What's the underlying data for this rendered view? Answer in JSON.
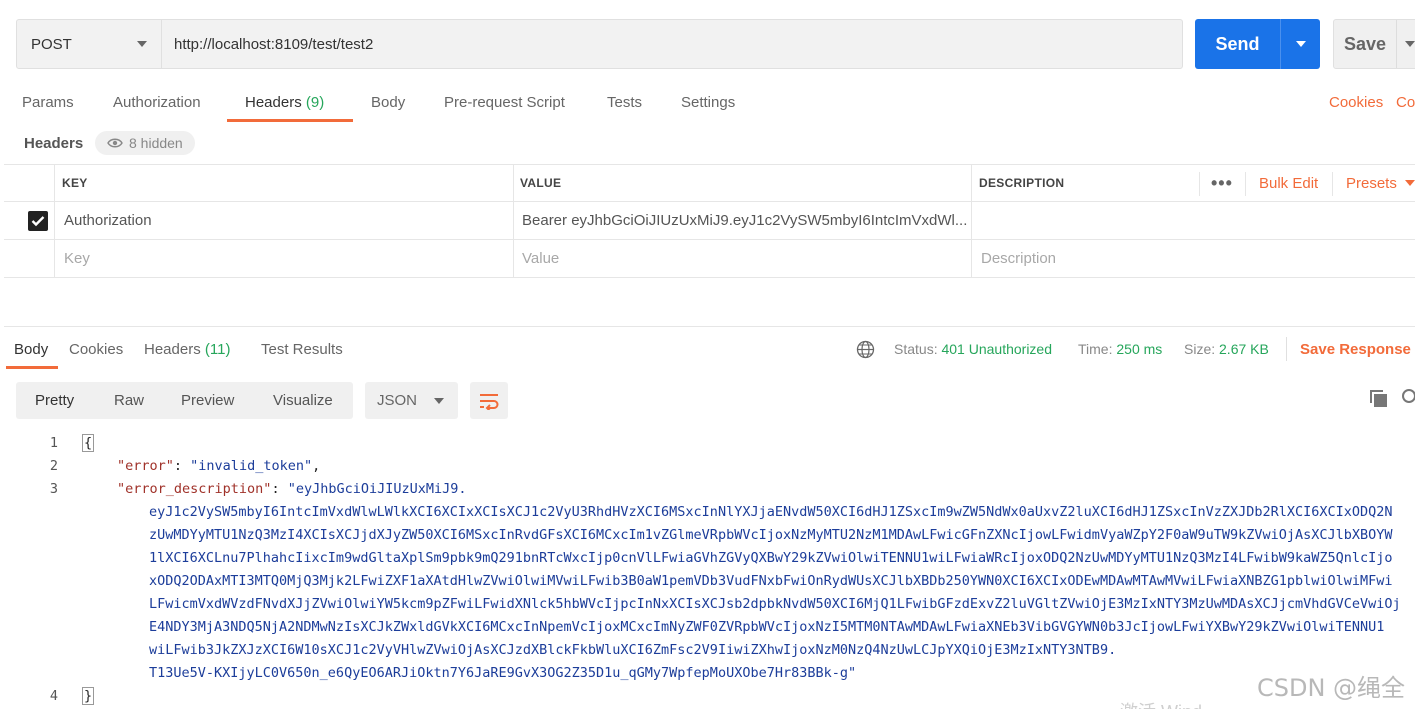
{
  "request": {
    "method": "POST",
    "url": "http://localhost:8109/test/test2",
    "send_label": "Send",
    "save_label": "Save"
  },
  "request_tabs": [
    {
      "label": "Params"
    },
    {
      "label": "Authorization"
    },
    {
      "label": "Headers",
      "count": "(9)"
    },
    {
      "label": "Body"
    },
    {
      "label": "Pre-request Script"
    },
    {
      "label": "Tests"
    },
    {
      "label": "Settings"
    }
  ],
  "right_links": {
    "cookies": "Cookies",
    "code": "Co"
  },
  "headers_section": {
    "title": "Headers",
    "hidden": "8 hidden"
  },
  "headers_table": {
    "columns": {
      "key": "KEY",
      "value": "VALUE",
      "description": "DESCRIPTION"
    },
    "more": "•••",
    "bulk_edit": "Bulk Edit",
    "presets": "Presets",
    "rows": [
      {
        "key": "Authorization",
        "value": "Bearer eyJhbGciOiJIUzUxMiJ9.eyJ1c2VySW5mbyI6IntcImVxdWl..."
      }
    ],
    "placeholder": {
      "key": "Key",
      "value": "Value",
      "description": "Description"
    }
  },
  "response_tabs": [
    {
      "label": "Body"
    },
    {
      "label": "Cookies"
    },
    {
      "label": "Headers",
      "count": "(11)"
    },
    {
      "label": "Test Results"
    }
  ],
  "response_status": {
    "status_label": "Status:",
    "status_value": "401 Unauthorized",
    "time_label": "Time:",
    "time_value": "250 ms",
    "size_label": "Size:",
    "size_value": "2.67 KB",
    "save_response": "Save Response"
  },
  "format_tabs": [
    "Pretty",
    "Raw",
    "Preview",
    "Visualize"
  ],
  "format_select": "JSON",
  "code": {
    "line_numbers": [
      "1",
      "2",
      "3",
      "4"
    ],
    "open_brace": "{",
    "close_brace": "}",
    "error_key": "\"error\"",
    "error_value": "\"invalid_token\"",
    "desc_key": "\"error_description\"",
    "desc_lines": [
      "\"eyJhbGciOiJIUzUxMiJ9.",
      "eyJ1c2VySW5mbyI6IntcImVxdWlwLWlkXCI6XCIxXCIsXCJ1c2VyU3RhdHVzXCI6MSxcInNlYXJjaENvdW50XCI6dHJ1ZSxcIm9wZW5NdWx0aUxvZ2luXCI6dHJ1ZSxcInVzZXJDb2RlXCI6XCIxODQ2N",
      "zUwMDYyMTU1NzQ3MzI4XCIsXCJjdXJyZW50XCI6MSxcInRvdGFsXCI6MCxcIm1vZGlmeVRpbWVcIjoxNzMyMTU2NzM1MDAwLFwicGFnZXNcIjowLFwidmVyaWZpY2F0aW9uTW9kZVwiOjAsXCJlbXBOYW",
      "1lXCI6XCLnu7PlhahcIixcIm9wdGltaXplSm9pbk9mQ291bnRTcWxcIjp0cnVlLFwiaGVhZGVyQXBwY29kZVwiOlwiTENNU1wiLFwiaWRcIjoxODQ2NzUwMDYyMTU1NzQ3MzI4LFwibW9kaWZ5QnlcIjo",
      "xODQ2ODAxMTI3MTQ0MjQ3Mjk2LFwiZXF1aXAtdHlwZVwiOlwiMVwiLFwib3B0aW1pemVDb3VudFNxbFwiOnRydWUsXCJlbXBDb250YWN0XCI6XCIxODEwMDAwMTAwMVwiLFwiaXNBZG1pblwiOlwiMFwi",
      "LFwicmVxdWVzdFNvdXJjZVwiOlwiYW5kcm9pZFwiLFwidXNlck5hbWVcIjpcInNxXCIsXCJsb2dpbkNvdW50XCI6MjQ1LFwibGFzdExvZ2luVGltZVwiOjE3MzIxNTY3MzUwMDAsXCJjcmVhdGVCeVwiOj",
      "E4NDY3MjA3NDQ5NjA2NDMwNzIsXCJkZWxldGVkXCI6MCxcInNpemVcIjoxMCxcImNyZWF0ZVRpbWVcIjoxNzI5MTM0NTAwMDAwLFwiaXNEb3VibGVGYWN0b3JcIjowLFwiYXBwY29kZVwiOlwiTENNU1",
      "wiLFwib3JkZXJzXCI6W10sXCJ1c2VyVHlwZVwiOjAsXCJzdXBlckFkbWluXCI6ZmFsc2V9IiwiZXhwIjoxNzM0NzQ4NzUwLCJpYXQiOjE3MzIxNTY3NTB9.",
      "T13Ue5V-KXIjyLC0V650n_e6QyEO6ARJiOktn7Y6JaRE9GvX3OG2Z35D1u_qGMy7WpfepMoUXObe7Hr83BBk-g\""
    ]
  },
  "watermark": "CSDN @绳全",
  "watermark2": "激活 Wind"
}
